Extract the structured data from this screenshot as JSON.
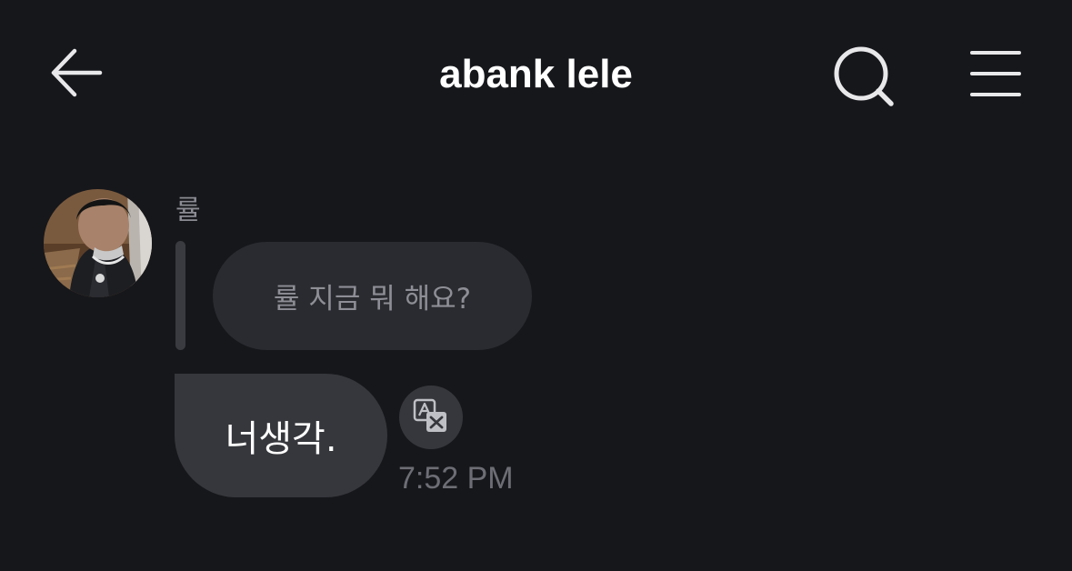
{
  "header": {
    "title": "abank lele",
    "back_icon": "arrow-left-icon",
    "search_icon": "search-icon",
    "menu_icon": "hamburger-menu-icon"
  },
  "conversation": {
    "sender_name": "률",
    "quoted_message": "률 지금 뭐 해요?",
    "message": "너생각.",
    "timestamp": "7:52 PM",
    "translate_icon": "translate-icon"
  },
  "colors": {
    "background": "#16171b",
    "bubble": "#36373c",
    "quoted_bubble": "#2a2b30",
    "muted_text": "#8b8c93"
  }
}
